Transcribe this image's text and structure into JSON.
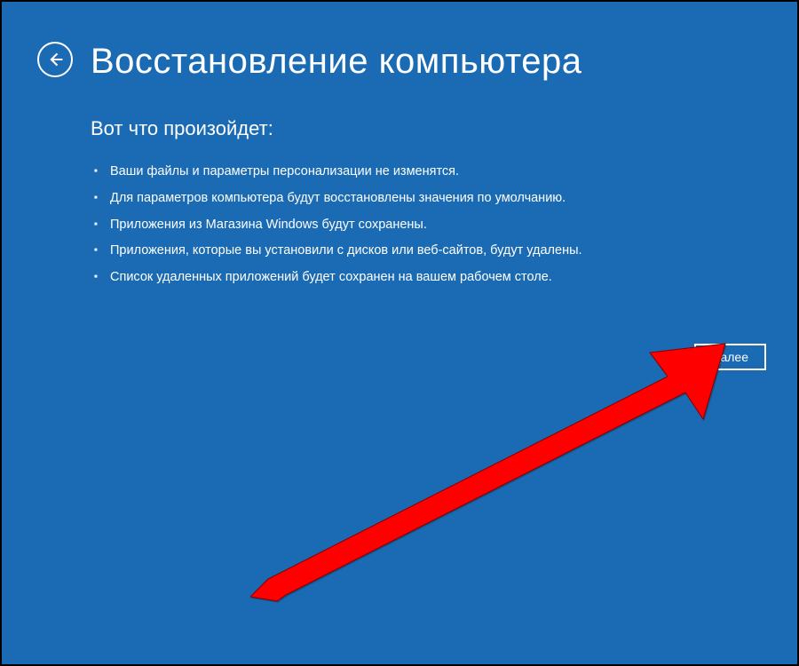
{
  "header": {
    "title": "Восстановление компьютера"
  },
  "content": {
    "subtitle": "Вот что произойдет:",
    "bullets": [
      "Ваши файлы и параметры персонализации не изменятся.",
      "Для параметров компьютера будут восстановлены значения по умолчанию.",
      "Приложения из Магазина Windows будут сохранены.",
      "Приложения, которые вы установили с дисков или веб-сайтов, будут удалены.",
      "Список удаленных приложений будет сохранен на вашем рабочем столе."
    ]
  },
  "buttons": {
    "next_label": "Далее"
  },
  "colors": {
    "background": "#1a6bb3",
    "text": "#ffffff",
    "annotation": "#ff0000"
  }
}
